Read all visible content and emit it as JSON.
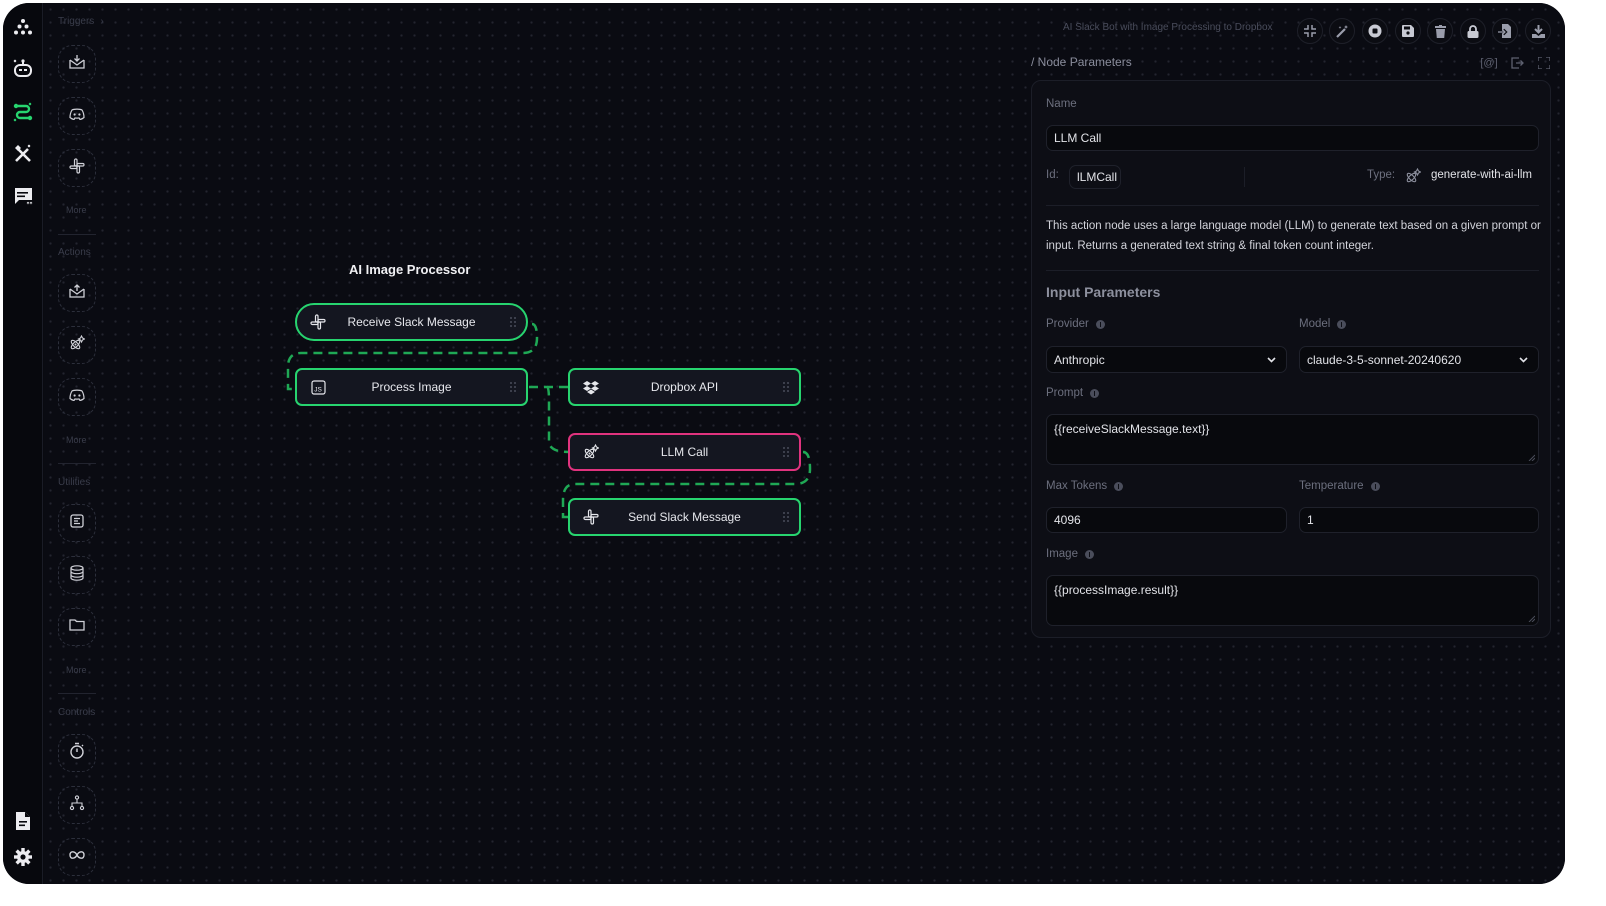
{
  "app": {
    "flow_name": "AI Slack Bot with Image Processing to Dropbox"
  },
  "rail": {
    "items": [
      {
        "name": "logo-icon",
        "label": "Home"
      },
      {
        "name": "robot-icon",
        "label": "Bots"
      },
      {
        "name": "workflow-icon",
        "label": "Workflows",
        "active": true
      },
      {
        "name": "tools-icon",
        "label": "Tools"
      },
      {
        "name": "chat-icon",
        "label": "Chat"
      }
    ],
    "bottom": [
      {
        "name": "document-icon",
        "label": "Docs"
      },
      {
        "name": "gear-icon",
        "label": "Settings"
      }
    ]
  },
  "palette": {
    "sections": [
      {
        "title": "Triggers",
        "has_chevron": true,
        "items": [
          "mail-receive-icon",
          "discord-icon",
          "slack-icon"
        ],
        "more": "More"
      },
      {
        "title": "Actions",
        "items": [
          "mail-send-icon",
          "ai-sparkle-icon",
          "discord-icon"
        ],
        "more": "More"
      },
      {
        "title": "Utilities",
        "items": [
          "text-icon",
          "database-icon",
          "folder-icon"
        ],
        "more": "More"
      },
      {
        "title": "Controls",
        "items": [
          "timer-icon",
          "branch-icon",
          "loop-icon"
        ]
      }
    ]
  },
  "canvas": {
    "flow_title": "AI Image Processor",
    "nodes": [
      {
        "id": "receiveSlackMessage",
        "label": "Receive Slack Message",
        "icon": "slack-icon",
        "kind": "trigger",
        "selected": false
      },
      {
        "id": "processImage",
        "label": "Process Image",
        "icon": "javascript-icon",
        "kind": "action",
        "selected": false
      },
      {
        "id": "dropboxApi",
        "label": "Dropbox API",
        "icon": "dropbox-icon",
        "kind": "action",
        "selected": false
      },
      {
        "id": "llmCall",
        "label": "LLM Call",
        "icon": "ai-sparkle-icon",
        "kind": "action",
        "selected": true
      },
      {
        "id": "sendSlackMessage",
        "label": "Send Slack Message",
        "icon": "slack-icon",
        "kind": "action",
        "selected": false
      }
    ],
    "colors": {
      "edge": "#1fa855",
      "node_border": "#27d46f",
      "selected_border": "#e0337e"
    }
  },
  "toolbar": {
    "buttons": [
      {
        "name": "collapse-button",
        "icon": "collapse-icon",
        "label": "Collapse"
      },
      {
        "name": "magic-button",
        "icon": "magic-wand-icon",
        "label": "Auto layout"
      },
      {
        "name": "stop-button",
        "icon": "stop-icon",
        "label": "Stop"
      },
      {
        "name": "save-button",
        "icon": "save-icon",
        "label": "Save"
      },
      {
        "name": "delete-button",
        "icon": "trash-icon",
        "label": "Delete"
      },
      {
        "name": "lock-button",
        "icon": "lock-icon",
        "label": "Lock"
      },
      {
        "name": "import-button",
        "icon": "import-icon",
        "label": "Import"
      },
      {
        "name": "download-button",
        "icon": "download-icon",
        "label": "Download"
      }
    ]
  },
  "node_params": {
    "title": "/ Node Parameters",
    "tools": {
      "mention": "[@]"
    },
    "name_label": "Name",
    "name_value": "LLM Call",
    "id_label": "Id:",
    "id_value": "lLMCall",
    "type_label": "Type:",
    "type_value": "generate-with-ai-llm",
    "description": "This action node uses a large language model (LLM) to generate text based on a given prompt or input. Returns a generated text string & final token count integer.",
    "input_title": "Input Parameters",
    "provider_label": "Provider",
    "provider_value": "Anthropic",
    "model_label": "Model",
    "model_value": "claude-3-5-sonnet-20240620",
    "prompt_label": "Prompt",
    "prompt_value": "{{receiveSlackMessage.text}}",
    "max_tokens_label": "Max Tokens",
    "max_tokens_value": "4096",
    "temperature_label": "Temperature",
    "temperature_value": "1",
    "image_label": "Image",
    "image_value": "{{processImage.result}}"
  }
}
